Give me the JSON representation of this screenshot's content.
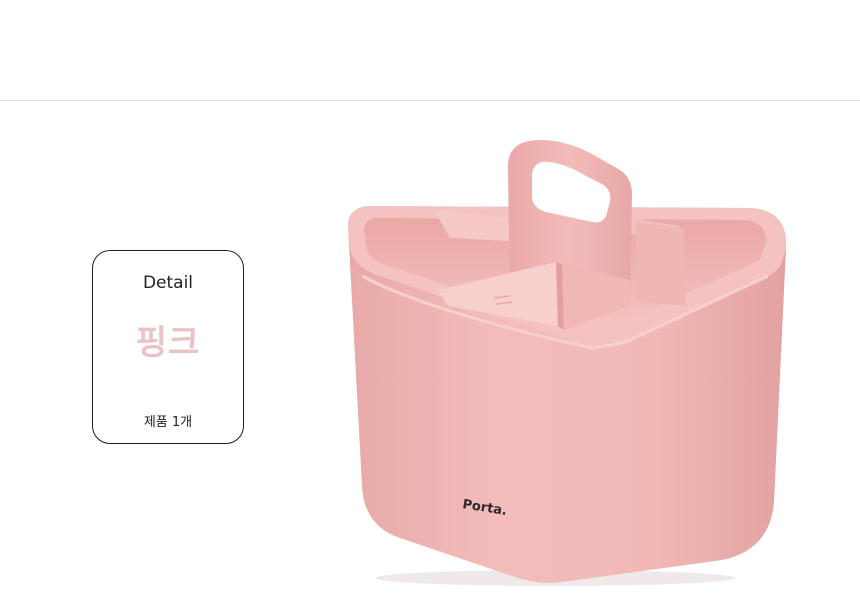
{
  "detail_card": {
    "title": "Detail",
    "color_name": "핑크",
    "quantity": "제품 1개"
  },
  "product": {
    "brand": "Porta.",
    "icon": "pink-caddy-organizer-image"
  },
  "colors": {
    "accent_pink_text": "#eac3c5",
    "product_pink": "#f0b9b7",
    "border": "#1f1f1f"
  }
}
